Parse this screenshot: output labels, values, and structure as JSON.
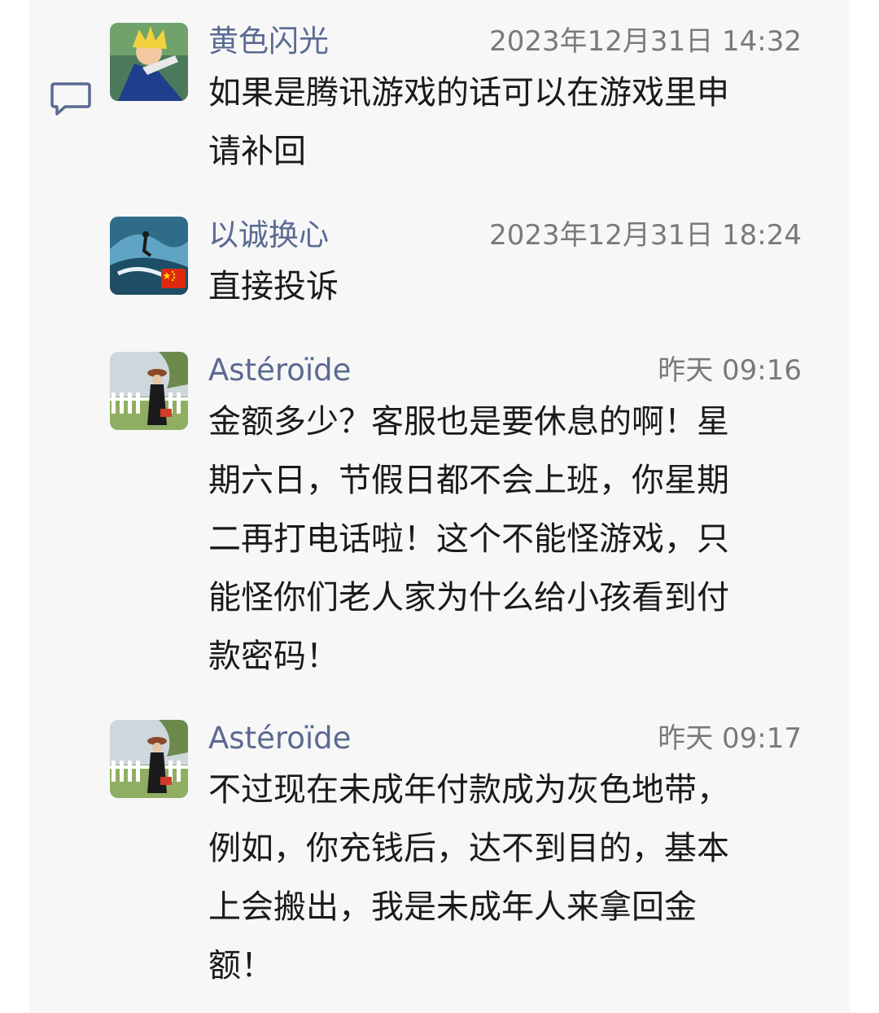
{
  "comments": [
    {
      "author": "黄色闪光",
      "time": "2023年12月31日 14:32",
      "avatar_icon": "anime-character-avatar",
      "lines": [
        "如果是腾讯游戏的话可以在游戏里申",
        "请补回"
      ]
    },
    {
      "author": "以诚换心",
      "time": "2023年12月31日 18:24",
      "avatar_icon": "surfer-avatar",
      "badge_icon": "china-flag-icon",
      "lines": [
        "直接投诉"
      ]
    },
    {
      "author": "Astéroïde",
      "time": "昨天 09:16",
      "avatar_icon": "person-garden-avatar",
      "lines": [
        "金额多少？客服也是要休息的啊！星",
        "期六日，节假日都不会上班，你星期",
        "二再打电话啦！这个不能怪游戏，只",
        "能怪你们老人家为什么给小孩看到付",
        "款密码！"
      ]
    },
    {
      "author": "Astéroïde",
      "time": "昨天 09:17",
      "avatar_icon": "person-garden-avatar",
      "lines": [
        "不过现在未成年付款成为灰色地带，",
        "例如，你充钱后，达不到目的，基本",
        "上会搬出，我是未成年人来拿回金",
        "额！"
      ]
    }
  ],
  "colors": {
    "name": "#5b6a92",
    "time": "#7a7a7a",
    "text": "#1a1a1a",
    "panel": "#f7f7f7",
    "icon": "#5b6a92"
  }
}
